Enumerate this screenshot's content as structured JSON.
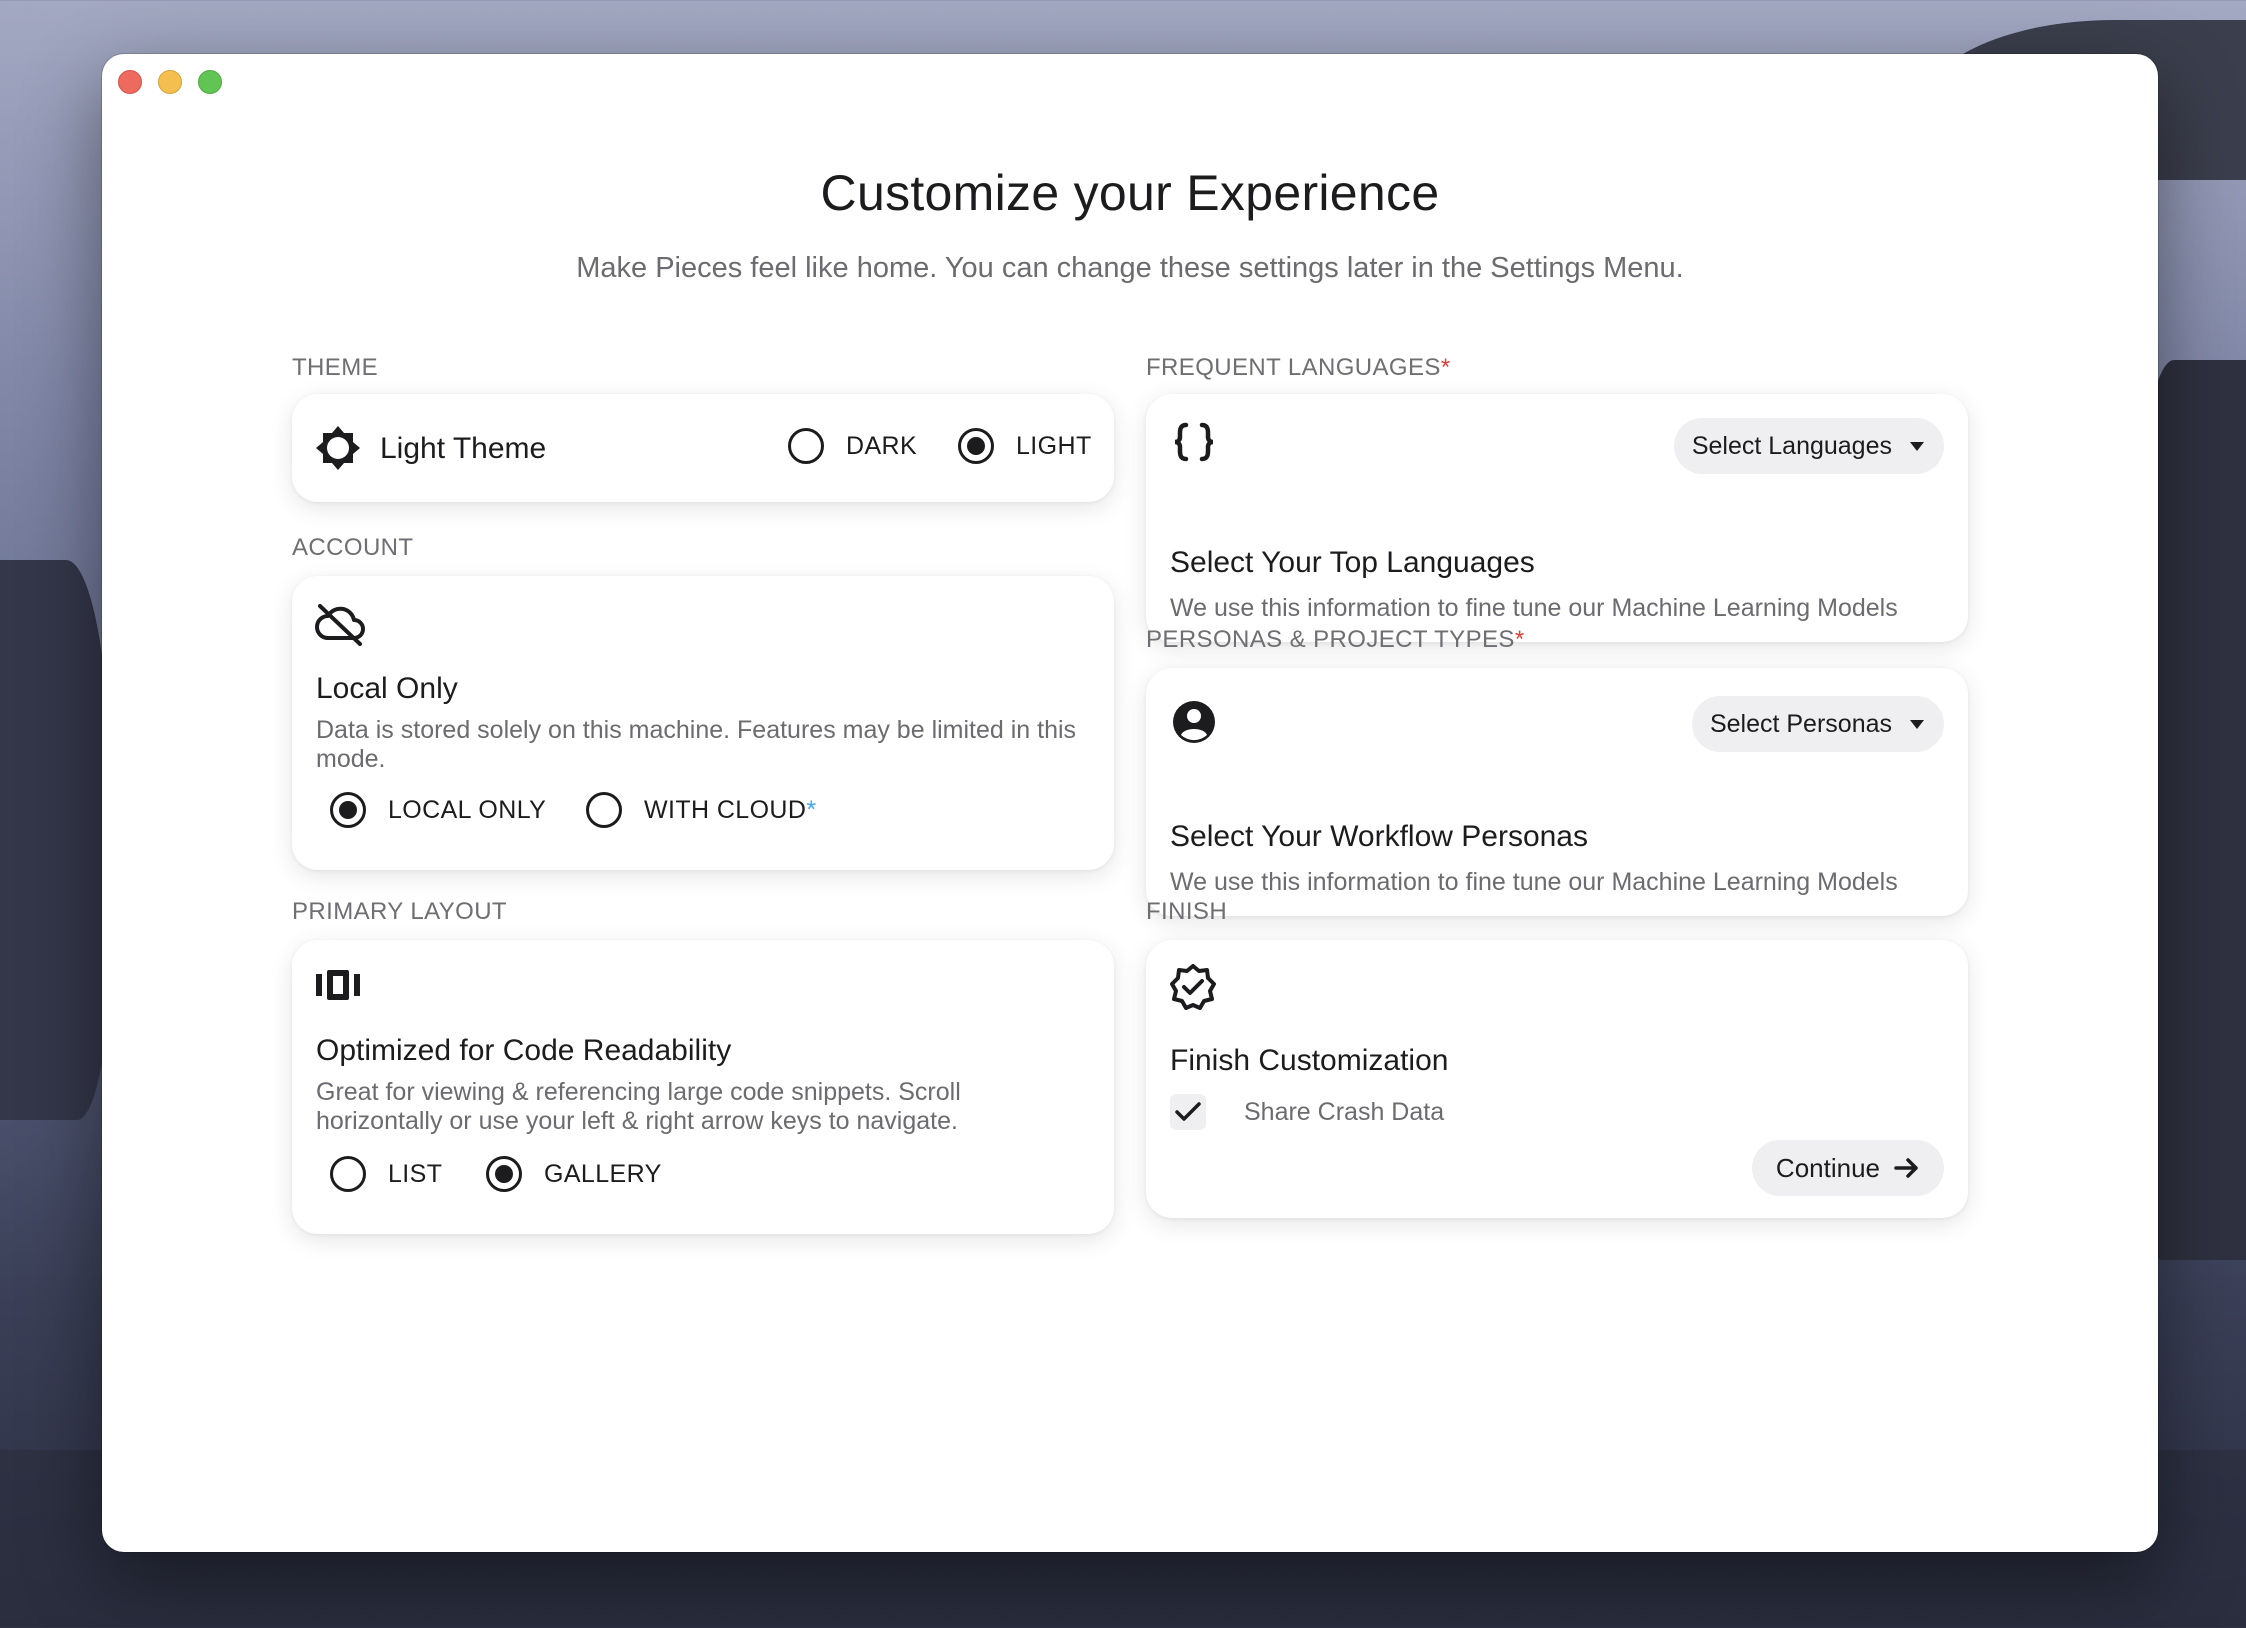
{
  "window": {
    "title": "Customize your Experience",
    "subtitle": "Make Pieces feel like home. You can change these settings later in the Settings Menu."
  },
  "theme": {
    "section_label": "THEME",
    "card_title": "Light Theme",
    "icon": "sun-icon",
    "options": [
      {
        "label": "DARK",
        "selected": false
      },
      {
        "label": "LIGHT",
        "selected": true
      }
    ]
  },
  "account": {
    "section_label": "ACCOUNT",
    "icon": "cloud-off-icon",
    "card_title": "Local Only",
    "description": "Data is stored solely on this machine. Features may be limited in this mode.",
    "options": [
      {
        "label": "LOCAL ONLY",
        "selected": true
      },
      {
        "label": "WITH CLOUD",
        "marker": "*",
        "selected": false
      }
    ]
  },
  "layout": {
    "section_label": "PRIMARY LAYOUT",
    "icon": "gallery-layout-icon",
    "card_title": "Optimized for Code Readability",
    "description": "Great for viewing & referencing large code snippets. Scroll horizontally or use your left & right arrow keys to navigate.",
    "options": [
      {
        "label": "LIST",
        "selected": false
      },
      {
        "label": "GALLERY",
        "selected": true
      }
    ]
  },
  "languages": {
    "section_label": "FREQUENT LANGUAGES",
    "required_marker": "*",
    "icon": "braces-icon",
    "button_label": "Select Languages",
    "card_title": "Select Your Top Languages",
    "description": "We use this information to fine tune our Machine Learning Models"
  },
  "personas": {
    "section_label": "PERSONAS & PROJECT TYPES",
    "required_marker": "*",
    "icon": "user-circle-icon",
    "button_label": "Select Personas",
    "card_title": "Select Your Workflow Personas",
    "description": "We use this information to fine tune our Machine Learning Models"
  },
  "finish": {
    "section_label": "FINISH",
    "icon": "verified-badge-icon",
    "card_title": "Finish Customization",
    "checkbox_label": "Share Crash Data",
    "checkbox_checked": true,
    "continue_label": "Continue"
  },
  "colors": {
    "required": "#e0413c",
    "cloud_marker": "#3da6e8",
    "text_primary": "#1c1c1e",
    "text_secondary": "#6b6b70"
  }
}
